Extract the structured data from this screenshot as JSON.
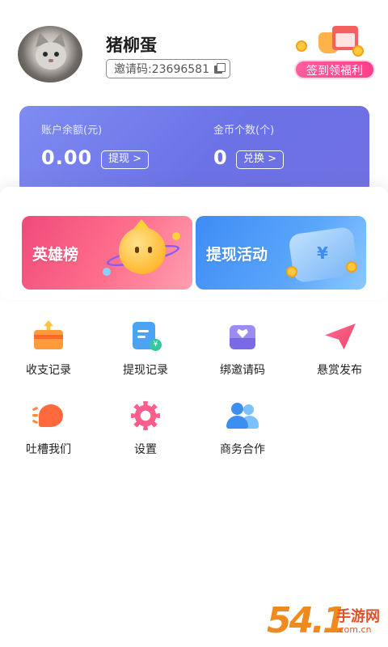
{
  "profile": {
    "username": "猪柳蛋",
    "invite_text": "邀请码:23696581"
  },
  "checkin": {
    "label": "签到领福利"
  },
  "balance": {
    "account_label": "账户余额(元)",
    "account_value": "0.00",
    "withdraw_button": "提现 >",
    "coins_label": "金币个数(个)",
    "coins_value": "0",
    "exchange_button": "兑换 >"
  },
  "promos": [
    {
      "title": "英雄榜",
      "color": "#f04a7a"
    },
    {
      "title": "提现活动",
      "color": "#3e8cf5"
    }
  ],
  "menu": [
    {
      "label": "收支记录",
      "icon": "income-expense-icon"
    },
    {
      "label": "提现记录",
      "icon": "withdraw-record-icon"
    },
    {
      "label": "绑邀请码",
      "icon": "bind-invite-icon"
    },
    {
      "label": "悬赏发布",
      "icon": "paper-plane-icon"
    },
    {
      "label": "吐槽我们",
      "icon": "feedback-icon"
    },
    {
      "label": "设置",
      "icon": "gear-icon"
    },
    {
      "label": "商务合作",
      "icon": "people-icon"
    }
  ],
  "watermark": {
    "number": "54.1",
    "site_cn": "手游网",
    "site_url": ".com.cn"
  },
  "colors": {
    "accent_purple": "#6b72e6",
    "checkin_pink": "#ff3f8a"
  }
}
